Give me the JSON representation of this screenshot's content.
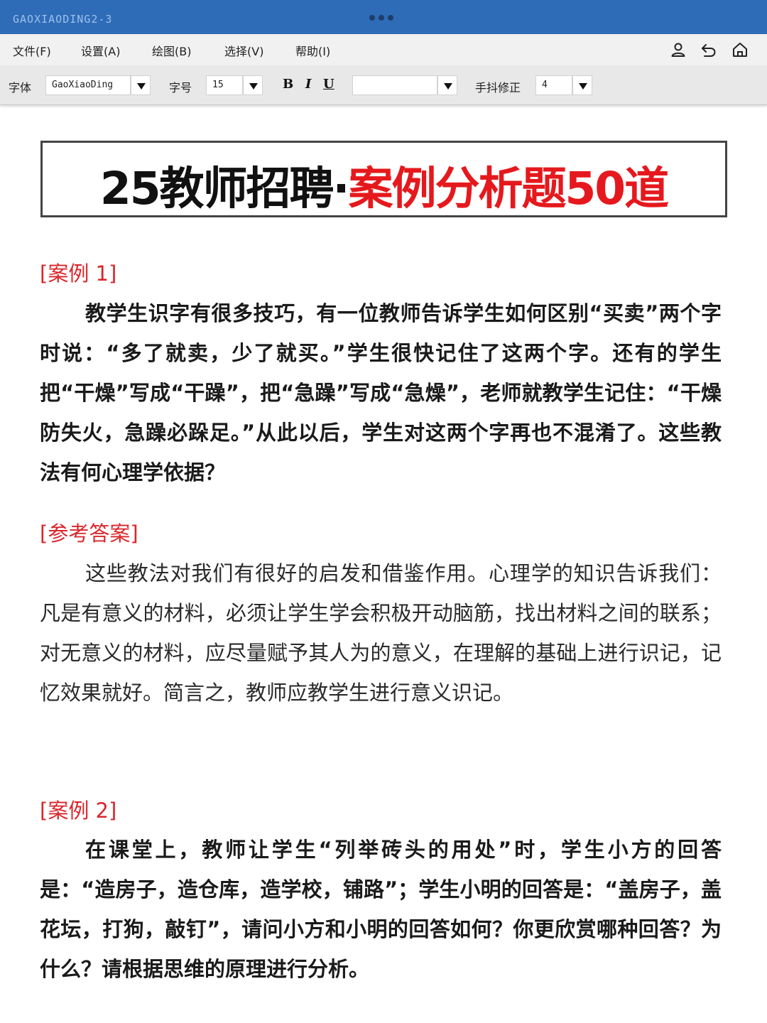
{
  "app": {
    "name": "GAOXIAODING2-3"
  },
  "menu": {
    "items": [
      "文件(F)",
      "设置(A)",
      "绘图(B)",
      "选择(V)",
      "帮助(I)"
    ],
    "icons": [
      "user-icon",
      "undo-icon",
      "home-icon"
    ]
  },
  "toolbar": {
    "font_label": "字体",
    "font_value": "GaoXiaoDing",
    "size_label": "字号",
    "size_value": "15",
    "bold": "B",
    "italic": "I",
    "underline": "U",
    "style_value": "",
    "shake_label": "手抖修正",
    "shake_value": "4"
  },
  "document": {
    "title_black": "25教师招聘·",
    "title_red": "案例分析题50道",
    "title_red_color": "#e5191d",
    "case1_tag": "[案例 1]",
    "case1_text": "教学生识字有很多技巧，有一位教师告诉学生如何区别“买卖”两个字时说：“多了就卖，少了就买。”学生很快记住了这两个字。还有的学生把“干燥”写成“干躁”，把“急躁”写成“急燥”，老师就教学生记住：“干燥防失火，急躁必跺足。”从此以后，学生对这两个字再也不混淆了。这些教法有何心理学依据？",
    "answer1_tag": "[参考答案]",
    "answer1_text": "这些教法对我们有很好的启发和借鉴作用。心理学的知识告诉我们：凡是有意义的材料，必须让学生学会积极开动脑筋，找出材料之间的联系；对无意义的材料，应尽量赋予其人为的意义，在理解的基础上进行识记，记忆效果就好。简言之，教师应教学生进行意义识记。",
    "case2_tag": "[案例 2]",
    "case2_text": "在课堂上，教师让学生“列举砖头的用处”时，学生小方的回答是：“造房子，造仓库，造学校，铺路”；学生小明的回答是：“盖房子，盖花坛，打狗，敲钉”，请问小方和小明的回答如何？你更欣赏哪种回答？为什么？请根据思维的原理进行分析。"
  }
}
